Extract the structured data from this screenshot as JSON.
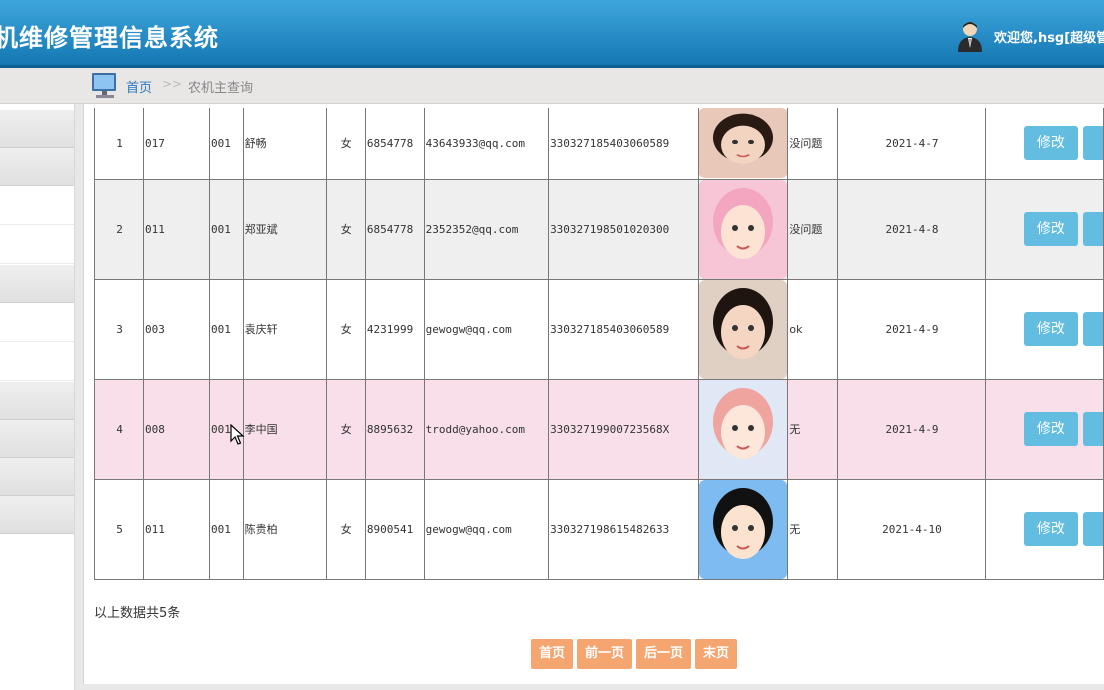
{
  "header": {
    "title": "机维修管理信息系统",
    "welcome": "欢迎您,hsg[超级管"
  },
  "breadcrumb": {
    "home": "首页",
    "separator": ">>",
    "current": "农机主查询"
  },
  "sidebar": {
    "items": [
      "",
      "",
      "",
      "",
      "",
      "",
      "",
      "",
      "",
      "",
      ""
    ]
  },
  "table": {
    "rows": [
      {
        "idx": "1",
        "code": "017",
        "group": "001",
        "name": "舒畅",
        "sex": "女",
        "phone": "6854778",
        "email": "43643933@qq.com",
        "idcard": "330327185403060589",
        "note": "没问题",
        "date": "2021-4-7",
        "edit": "修改"
      },
      {
        "idx": "2",
        "code": "011",
        "group": "001",
        "name": "郑亚斌",
        "sex": "女",
        "phone": "6854778",
        "email": "2352352@qq.com",
        "idcard": "330327198501020300",
        "note": "没问题",
        "date": "2021-4-8",
        "edit": "修改"
      },
      {
        "idx": "3",
        "code": "003",
        "group": "001",
        "name": "袁庆轩",
        "sex": "女",
        "phone": "4231999",
        "email": "gewogw@qq.com",
        "idcard": "330327185403060589",
        "note": "ok",
        "date": "2021-4-9",
        "edit": "修改"
      },
      {
        "idx": "4",
        "code": "008",
        "group": "001",
        "name": "李中国",
        "sex": "女",
        "phone": "8895632",
        "email": "trodd@yahoo.com",
        "idcard": "33032719900723568X",
        "note": "无",
        "date": "2021-4-9",
        "edit": "修改"
      },
      {
        "idx": "5",
        "code": "011",
        "group": "001",
        "name": "陈贵柏",
        "sex": "女",
        "phone": "8900541",
        "email": "gewogw@qq.com",
        "idcard": "330327198615482633",
        "note": "无",
        "date": "2021-4-10",
        "edit": "修改"
      }
    ]
  },
  "summary": "以上数据共5条",
  "pager": {
    "first": "首页",
    "prev": "前一页",
    "next": "后一页",
    "last": "末页"
  },
  "colors": {
    "header": "#1a86c4",
    "button": "#62bde0",
    "pager": "#f5a56f",
    "highlight_row": "#f8dfe9"
  }
}
